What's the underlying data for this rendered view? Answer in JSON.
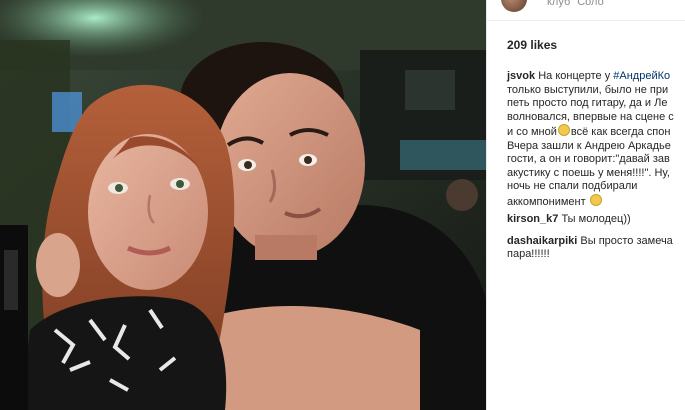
{
  "post": {
    "photo_alt": "selfie",
    "header": {
      "location": "клуб \"Соло\""
    },
    "likes_label": "209 likes",
    "caption": {
      "user": "jsvok",
      "line1_pre": "На концерте у",
      "hashtag": "#АндрейКо",
      "lines": [
        "только выступили, было не при",
        "петь просто под гитару, да и Ле",
        "волновался, впервые на сцене с",
        "и со мной",
        "всё как всегда спон",
        "Вчера зашли к Андрею Аркадье",
        "гости, а он и говорит:\"давай зав",
        "акустику с поешь у меня!!!!\". Ну,",
        "ночь не спали подбирали",
        "аккомпонимент"
      ]
    },
    "comments": [
      {
        "user": "kirson_k7",
        "text": "Ты молодец))"
      },
      {
        "user": "dashaikarpiki",
        "text": "Вы просто замеча",
        "text2": "пара!!!!!!"
      }
    ]
  }
}
